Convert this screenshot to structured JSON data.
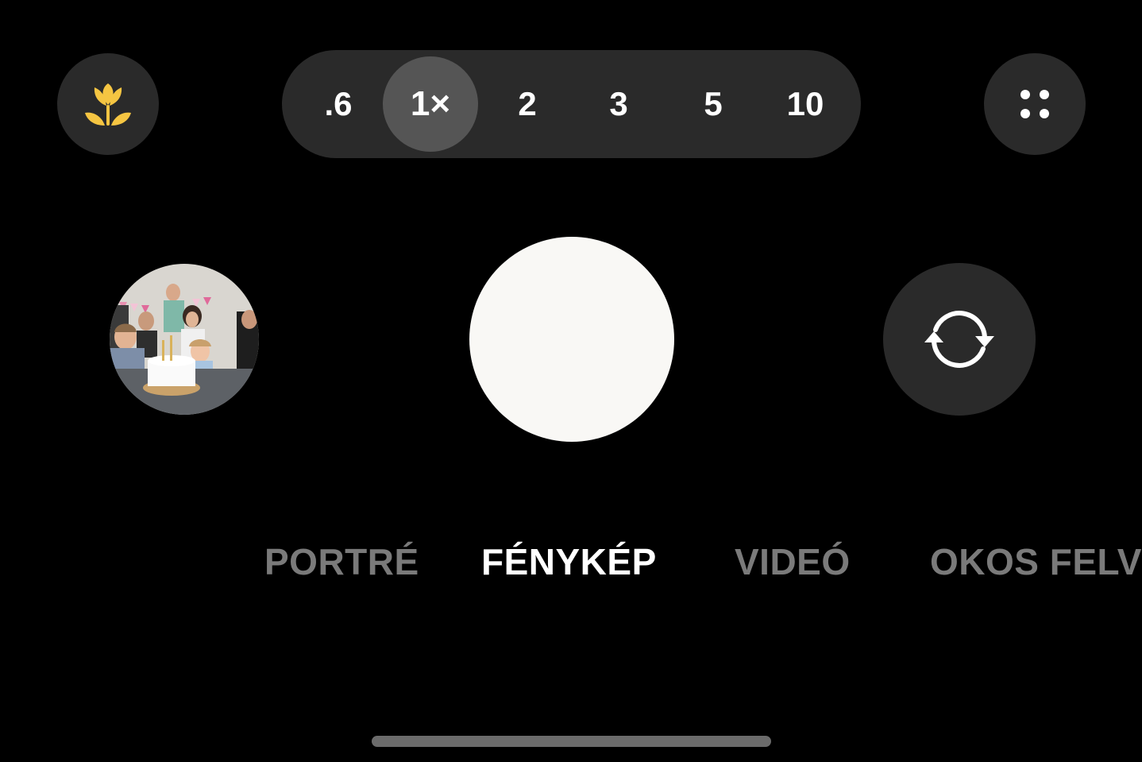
{
  "colors": {
    "background": "#000000",
    "button_bg": "#2a2a2a",
    "zoom_active_bg": "#555555",
    "macro_icon": "#f5c542",
    "shutter": "#f9f8f5",
    "mode_active": "#ffffff",
    "mode_inactive": "#7a7a7a",
    "home_indicator": "#6b6b6b"
  },
  "top_bar": {
    "macro_button": {
      "icon": "flower-macro-icon"
    },
    "zoom_options": [
      {
        "label": ".6",
        "active": false
      },
      {
        "label": "1×",
        "active": true
      },
      {
        "label": "2",
        "active": false
      },
      {
        "label": "3",
        "active": false
      },
      {
        "label": "5",
        "active": false
      },
      {
        "label": "10",
        "active": false
      }
    ],
    "more_button": {
      "icon": "four-dots-icon"
    }
  },
  "controls": {
    "gallery_thumbnail": {
      "icon": "photo-thumbnail"
    },
    "shutter_button": {
      "icon": "shutter-circle"
    },
    "flip_camera_button": {
      "icon": "rotate-camera-icon"
    }
  },
  "modes": [
    {
      "label": "PORTRÉ",
      "active": false
    },
    {
      "label": "FÉNYKÉP",
      "active": true
    },
    {
      "label": "VIDEÓ",
      "active": false
    },
    {
      "label": "OKOS FELVÉ",
      "active": false
    }
  ]
}
